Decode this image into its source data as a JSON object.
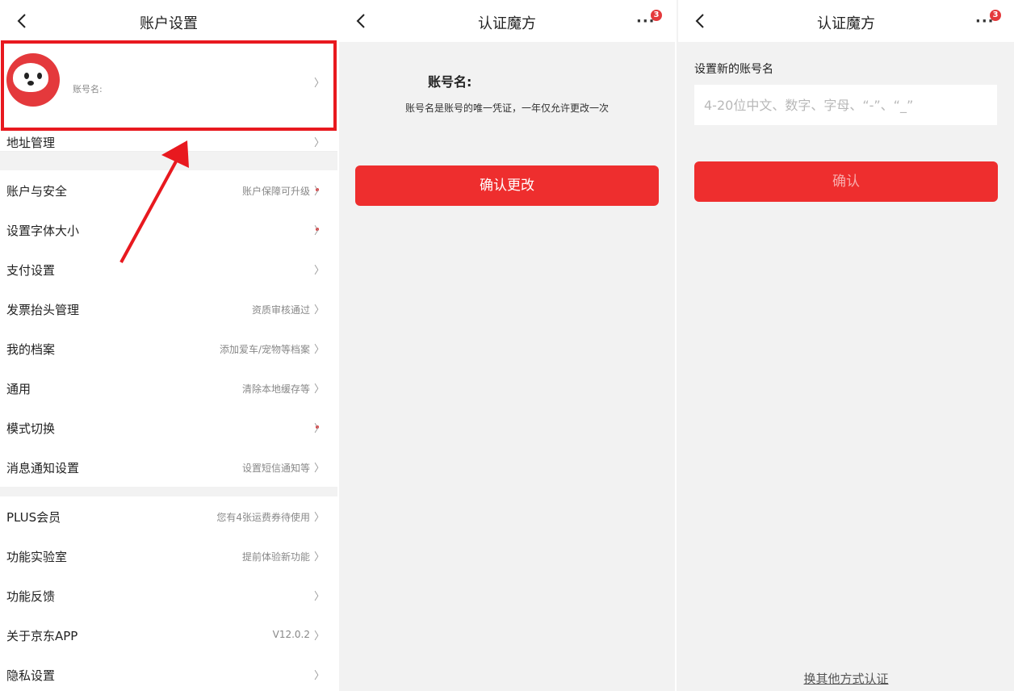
{
  "screen1": {
    "title": "账户设置",
    "profile": {
      "name_label": "账号名:"
    },
    "rows": [
      {
        "label": "地址管理",
        "value": "",
        "dot": false
      },
      {
        "label": "账户与安全",
        "value": "账户保障可升级",
        "dot": true
      },
      {
        "label": "设置字体大小",
        "value": "",
        "dot": true
      },
      {
        "label": "支付设置",
        "value": "",
        "dot": false
      },
      {
        "label": "发票抬头管理",
        "value": "资质审核通过",
        "dot": false
      },
      {
        "label": "我的档案",
        "value": "添加爱车/宠物等档案",
        "dot": false
      },
      {
        "label": "通用",
        "value": "清除本地缓存等",
        "dot": false
      },
      {
        "label": "模式切换",
        "value": "",
        "dot": true
      },
      {
        "label": "消息通知设置",
        "value": "设置短信通知等",
        "dot": false
      },
      {
        "label": "PLUS会员",
        "value": "您有4张运费券待使用",
        "dot": false
      },
      {
        "label": "功能实验室",
        "value": "提前体验新功能",
        "dot": false
      },
      {
        "label": "功能反馈",
        "value": "",
        "dot": false
      },
      {
        "label": "关于京东APP",
        "value": "V12.0.2",
        "dot": false
      },
      {
        "label": "隐私设置",
        "value": "",
        "dot": false
      }
    ]
  },
  "screen2": {
    "title": "认证魔方",
    "badge": "3",
    "account_title": "账号名:",
    "account_desc": "账号名是账号的唯一凭证，一年仅允许更改一次",
    "confirm_button": "确认更改"
  },
  "screen3": {
    "title": "认证魔方",
    "badge": "3",
    "field_label": "设置新的账号名",
    "field_placeholder": "4-20位中文、数字、字母、“-”、“_”",
    "field_value": "",
    "confirm_button": "确认",
    "alt_link": "换其他方式认证"
  },
  "colors": {
    "accent": "#ee2e2e",
    "highlight": "#e8191f"
  },
  "icons": {
    "back": "chevron-left-icon",
    "more": "more-dots-icon",
    "chevron": "chevron-right-icon"
  }
}
